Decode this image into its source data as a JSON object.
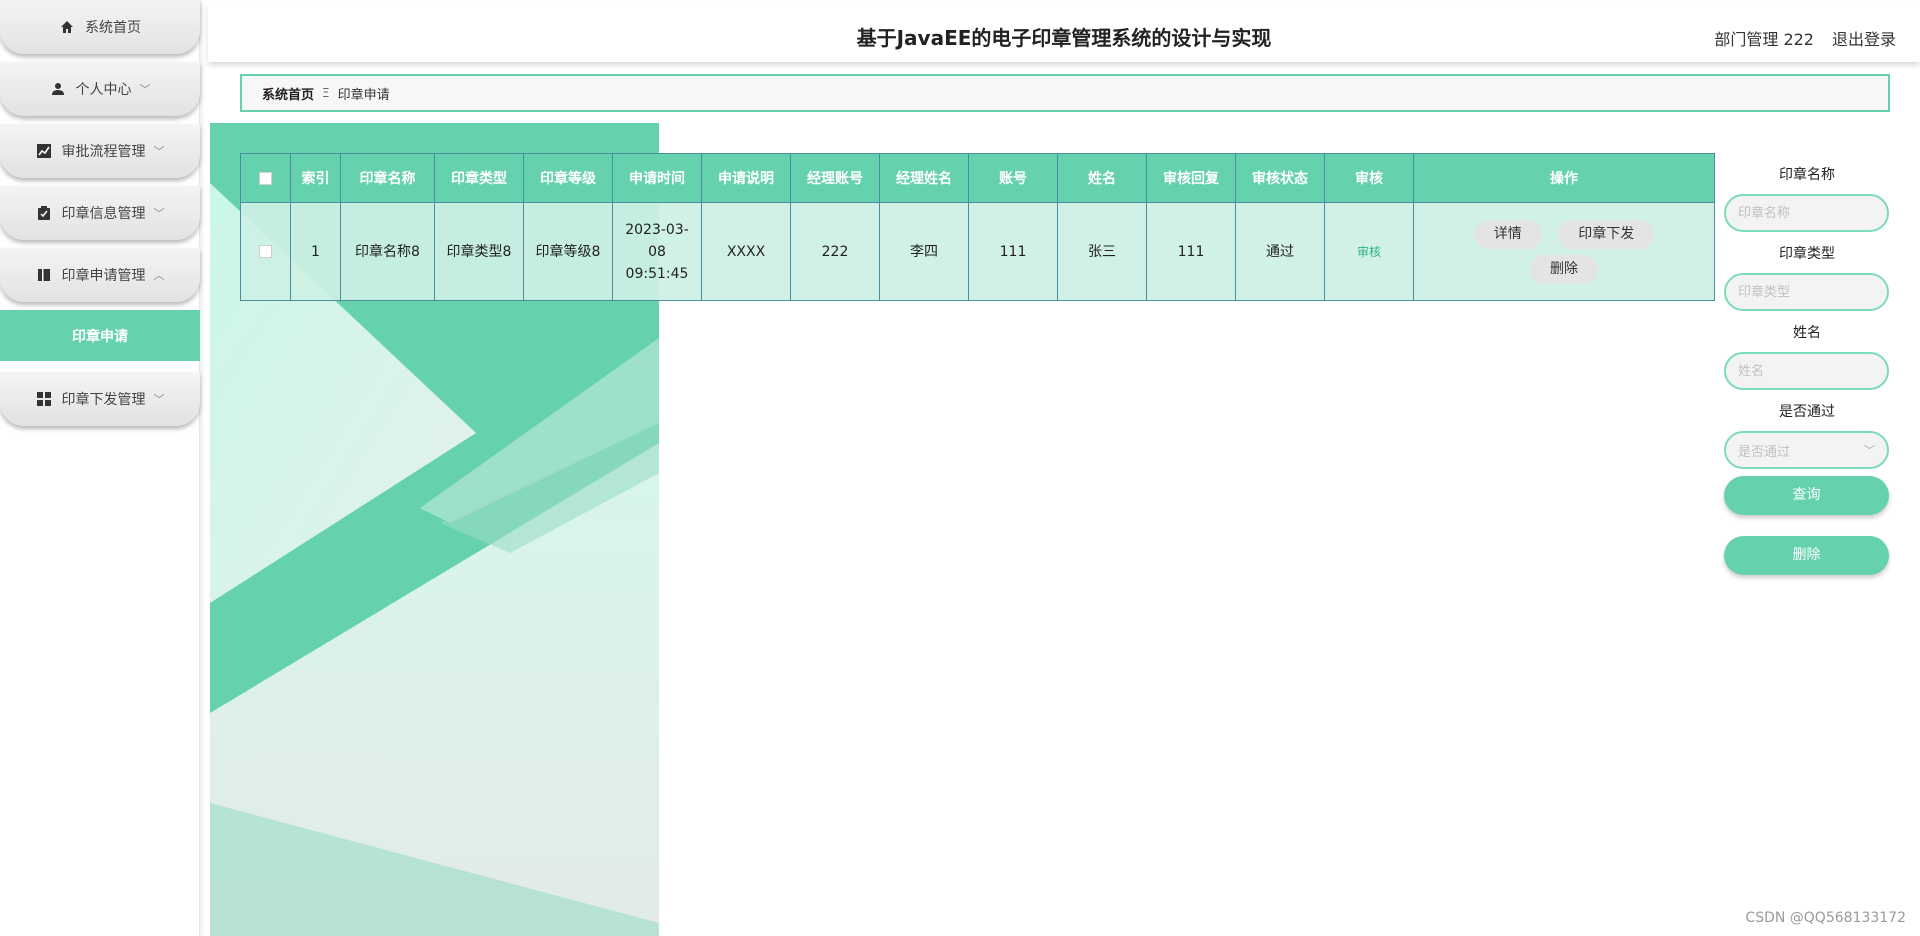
{
  "sidebar": {
    "items": [
      {
        "label": "系统首页",
        "icon": "home-icon"
      },
      {
        "label": "个人中心",
        "icon": "user-icon"
      },
      {
        "label": "审批流程管理",
        "icon": "chart-icon"
      },
      {
        "label": "印章信息管理",
        "icon": "clipboard-icon"
      },
      {
        "label": "印章申请管理",
        "icon": "book-icon"
      },
      {
        "label": "印章下发管理",
        "icon": "grid-icon"
      }
    ],
    "active_subitem": "印章申请"
  },
  "header": {
    "title": "基于JavaEE的电子印章管理系统的设计与实现",
    "user": "部门管理 222",
    "logout": "退出登录"
  },
  "breadcrumb": {
    "home": "系统首页",
    "separator": "Ξ",
    "current": "印章申请"
  },
  "table": {
    "columns": [
      "索引",
      "印章名称",
      "印章类型",
      "印章等级",
      "申请时间",
      "申请说明",
      "经理账号",
      "经理姓名",
      "账号",
      "姓名",
      "审核回复",
      "审核状态",
      "审核",
      "操作"
    ],
    "rows": [
      {
        "index": "1",
        "seal_name": "印章名称8",
        "seal_type": "印章类型8",
        "seal_level": "印章等级8",
        "apply_time": "2023-03-08 09:51:45",
        "apply_desc": "XXXX",
        "manager_account": "222",
        "manager_name": "李四",
        "account": "111",
        "name": "张三",
        "audit_reply": "111",
        "audit_status": "通过",
        "audit_link": "审核",
        "actions": {
          "detail": "详情",
          "issue": "印章下发",
          "delete": "删除"
        }
      }
    ]
  },
  "search": {
    "seal_name_label": "印章名称",
    "seal_name_placeholder": "印章名称",
    "seal_type_label": "印章类型",
    "seal_type_placeholder": "印章类型",
    "name_label": "姓名",
    "name_placeholder": "姓名",
    "passed_label": "是否通过",
    "passed_placeholder": "是否通过",
    "query_button": "查询",
    "delete_button": "删除"
  },
  "watermark": "CSDN @QQ568133172",
  "colors": {
    "accent": "#66d2ad",
    "accent_light": "#c7f5e4",
    "border": "#4a8ea0"
  }
}
